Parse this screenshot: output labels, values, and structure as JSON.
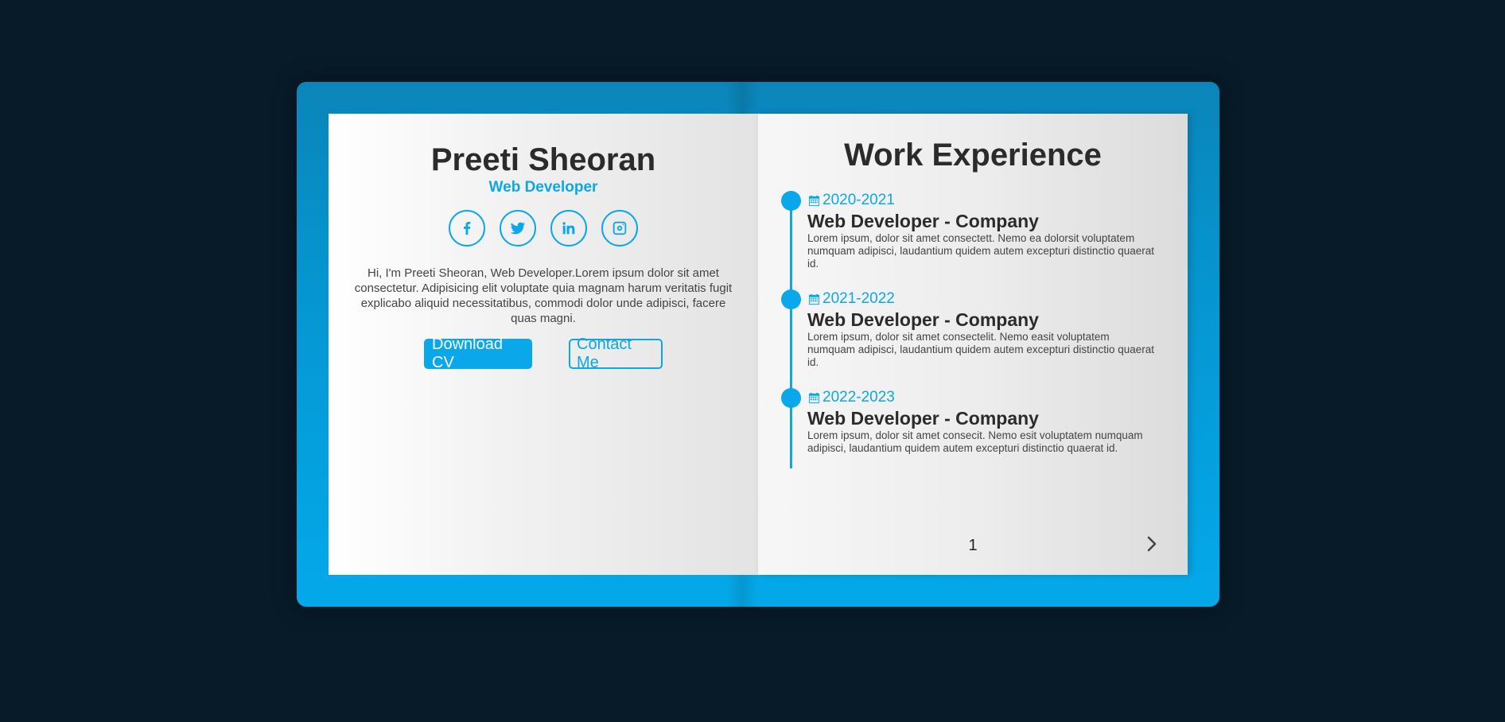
{
  "profile": {
    "name": "Preeti Sheoran",
    "role": "Web Developer",
    "intro": "Hi, I'm Preeti Sheoran, Web Developer.Lorem ipsum dolor sit amet consectetur. Adipisicing elit voluptate quia magnam harum veritatis fugit explicabo aliquid necessitatibus, commodi dolor unde adipisci, facere quas magni.",
    "socials": [
      "facebook-icon",
      "twitter-icon",
      "linkedin-icon",
      "instagram-icon"
    ],
    "download_label": "Download CV",
    "contact_label": "Contact Me"
  },
  "experience": {
    "title": "Work Experience",
    "items": [
      {
        "date": "2020-2021",
        "title": "Web Developer - Company",
        "text": "Lorem ipsum, dolor sit amet consectett. Nemo ea dolorsit voluptatem numquam adipisci, laudantium quidem autem excepturi distinctio quaerat id."
      },
      {
        "date": "2021-2022",
        "title": "Web Developer - Company",
        "text": "Lorem ipsum, dolor sit amet consectelit. Nemo easit voluptatem numquam adipisci, laudantium quidem autem excepturi distinctio quaerat id."
      },
      {
        "date": "2022-2023",
        "title": "Web Developer - Company",
        "text": "Lorem ipsum, dolor sit amet consecit. Nemo esit voluptatem numquam adipisci, laudantium quidem autem excepturi distinctio quaerat id."
      }
    ],
    "page_number": "1",
    "next_icon": "chevron-right-icon"
  },
  "colors": {
    "background": "#081b29",
    "accent": "#0aa8ea",
    "text": "#2b2b2b"
  }
}
